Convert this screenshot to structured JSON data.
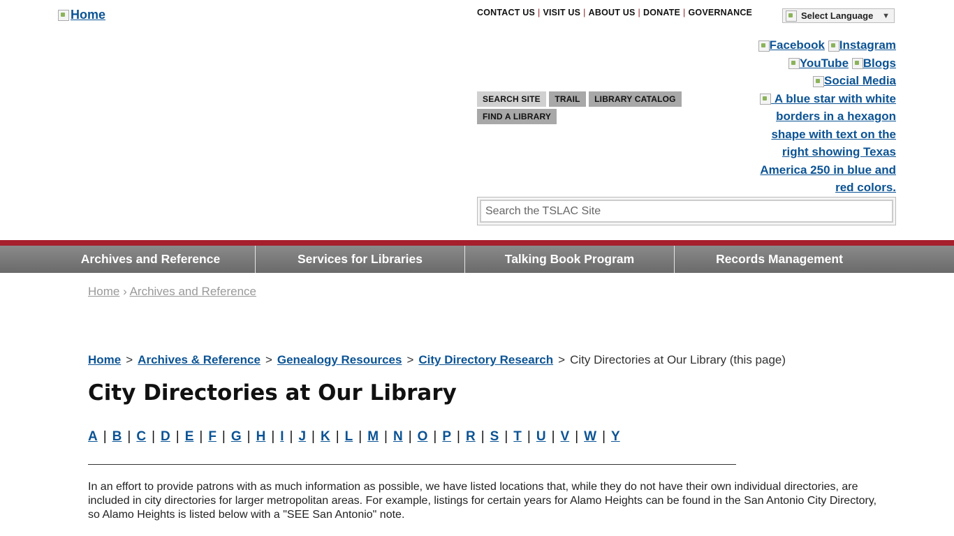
{
  "header": {
    "logo_alt": "Home",
    "utility_links": [
      "CONTACT US",
      "VISIT US",
      "ABOUT US",
      "DONATE",
      "GOVERNANCE"
    ],
    "language_label": "Select Language",
    "social_links": [
      "Facebook",
      "Instagram",
      "YouTube",
      "Blogs",
      "Social Media"
    ],
    "texas250_alt": "A blue star with white borders in a hexagon shape with text on the right showing Texas America 250 in blue and red colors.",
    "tabs": [
      "SEARCH SITE",
      "TRAIL",
      "LIBRARY CATALOG",
      "FIND A LIBRARY"
    ],
    "search_placeholder": "Search the TSLAC Site"
  },
  "nav": {
    "items": [
      "Archives and Reference",
      "Services for Libraries",
      "Talking Book Program",
      "Records Management"
    ]
  },
  "breadcrumb_top": {
    "home": "Home",
    "separator": "›",
    "current": "Archives and Reference"
  },
  "breadcrumb": {
    "links": [
      "Home",
      "Archives & Reference",
      "Genealogy Resources",
      "City Directory Research"
    ],
    "separator": ">",
    "current": "City Directories at Our Library (this page)"
  },
  "page_title": "City Directories at Our Library",
  "alphabet": [
    "A",
    "B",
    "C",
    "D",
    "E",
    "F",
    "G",
    "H",
    "I",
    "J",
    "K",
    "L",
    "M",
    "N",
    "O",
    "P",
    "R",
    "S",
    "T",
    "U",
    "V",
    "W",
    "Y"
  ],
  "intro": "In an effort to provide patrons with as much information as possible, we have listed locations that, while they do not have their own individual directories, are included in city directories for larger metropolitan areas.  For example, listings for certain years for Alamo Heights can be found in the San Antonio City Directory, so Alamo Heights is listed below with a \"SEE San Antonio\" note.",
  "colors": {
    "link": "#0b5394",
    "brand_red": "#a51f2d",
    "nav_gray": "#7a7a7a"
  }
}
